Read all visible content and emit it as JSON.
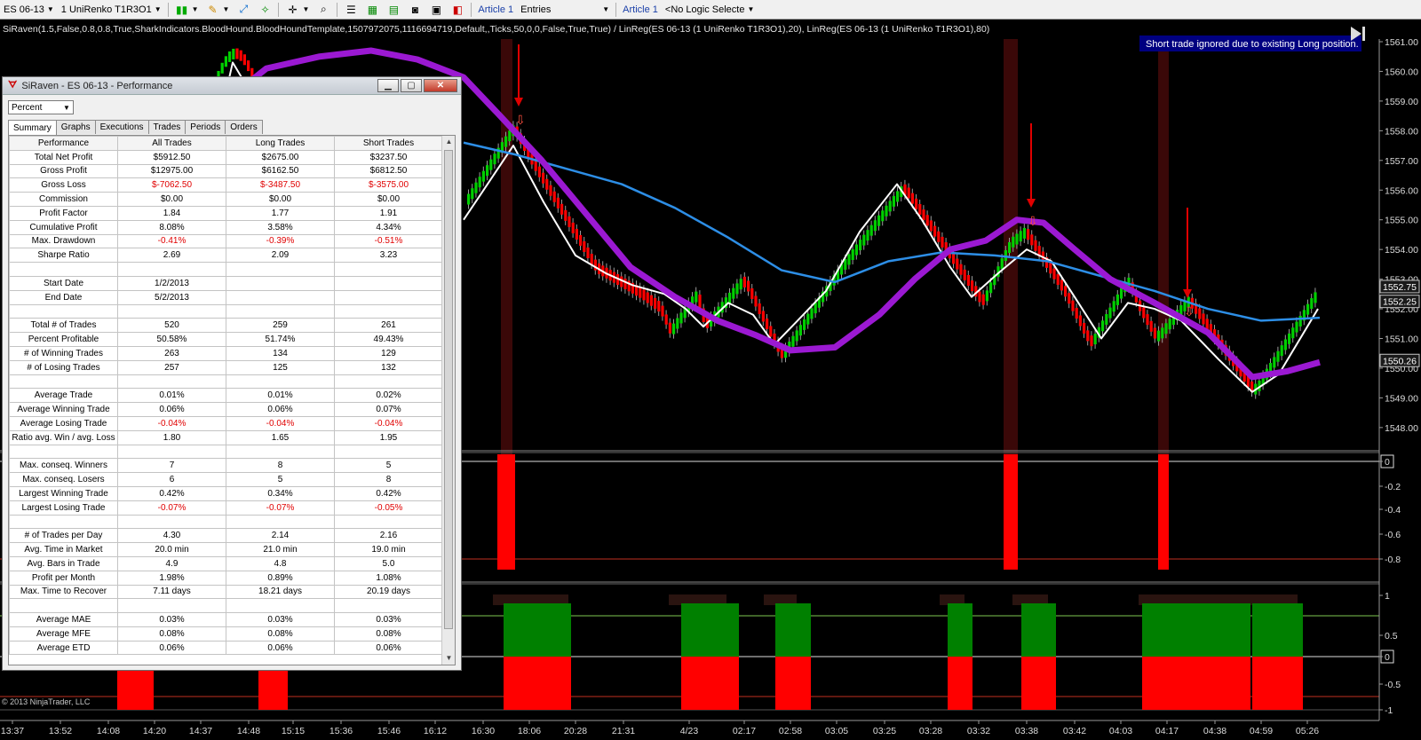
{
  "toolbar": {
    "instrument": "ES 06-13",
    "bar_type": "1 UniRenko T1R3O1",
    "article_a": "Article 1",
    "entries": "Entries",
    "article_b": "Article 1",
    "logic": "<No Logic Selecte"
  },
  "indicator_label": "SiRaven(1.5,False,0.8,0.8,True,SharkIndicators.BloodHound.BloodHoundTemplate,1507972075,1116694719,Default,,Ticks,50,0,0,False,True,True)  /  LinReg(ES 06-13 (1 UniRenko T1R3O1),20),  LinReg(ES 06-13 (1 UniRenko T1R3O1),80)",
  "notice": "Short trade ignored due to existing Long position.",
  "copyright": "© 2013 NinjaTrader, LLC",
  "price_axis": [
    "1561.00",
    "1560.00",
    "1559.00",
    "1558.00",
    "1557.00",
    "1556.00",
    "1555.00",
    "1554.00",
    "1553.00",
    "1552.00",
    "1551.00",
    "1550.00",
    "1549.00",
    "1548.00"
  ],
  "price_tags": [
    {
      "value": "1552.75",
      "color": "#c8c8c8"
    },
    {
      "value": "1552.25",
      "color": "#c8c8c8"
    },
    {
      "value": "1550.26",
      "color": "#c8c8c8"
    }
  ],
  "panel2_axis": [
    "0",
    "-0.2",
    "-0.4",
    "-0.6",
    "-0.8"
  ],
  "panel3_axis": [
    "1",
    "0.5",
    "0",
    "-0.5",
    "-1"
  ],
  "time_axis": [
    "13:37",
    "13:52",
    "14:08",
    "14:20",
    "14:37",
    "14:48",
    "15:15",
    "15:36",
    "15:46",
    "16:12",
    "16:30",
    "18:06",
    "20:28",
    "21:31",
    "4/23",
    "02:17",
    "02:58",
    "03:05",
    "03:25",
    "03:28",
    "03:32",
    "03:38",
    "03:42",
    "04:03",
    "04:17",
    "04:38",
    "04:59",
    "05:26"
  ],
  "colors": {
    "up": "#00d000",
    "down": "#ff0000",
    "linreg20": "#ffffff",
    "linreg80": "#2d8ee6",
    "siraven": "#9b19d2",
    "green_block": "#008000",
    "red_block": "#ff0000"
  },
  "perf": {
    "title": "SiRaven - ES 06-13 - Performance",
    "select": "Percent",
    "tabs": [
      "Summary",
      "Graphs",
      "Executions",
      "Trades",
      "Periods",
      "Orders"
    ],
    "headers": [
      "Performance",
      "All Trades",
      "Long Trades",
      "Short Trades"
    ],
    "rows": [
      [
        "Total Net Profit",
        "$5912.50",
        "$2675.00",
        "$3237.50"
      ],
      [
        "Gross Profit",
        "$12975.00",
        "$6162.50",
        "$6812.50"
      ],
      [
        "Gross Loss",
        "$-7062.50",
        "$-3487.50",
        "$-3575.00"
      ],
      [
        "Commission",
        "$0.00",
        "$0.00",
        "$0.00"
      ],
      [
        "Profit Factor",
        "1.84",
        "1.77",
        "1.91"
      ],
      [
        "Cumulative Profit",
        "8.08%",
        "3.58%",
        "4.34%"
      ],
      [
        "Max. Drawdown",
        "-0.41%",
        "-0.39%",
        "-0.51%"
      ],
      [
        "Sharpe Ratio",
        "2.69",
        "2.09",
        "3.23"
      ],
      [
        "",
        "",
        "",
        ""
      ],
      [
        "Start Date",
        "1/2/2013",
        "",
        ""
      ],
      [
        "End Date",
        "5/2/2013",
        "",
        ""
      ],
      [
        "",
        "",
        "",
        ""
      ],
      [
        "Total # of Trades",
        "520",
        "259",
        "261"
      ],
      [
        "Percent Profitable",
        "50.58%",
        "51.74%",
        "49.43%"
      ],
      [
        "# of Winning Trades",
        "263",
        "134",
        "129"
      ],
      [
        "# of Losing Trades",
        "257",
        "125",
        "132"
      ],
      [
        "",
        "",
        "",
        ""
      ],
      [
        "Average Trade",
        "0.01%",
        "0.01%",
        "0.02%"
      ],
      [
        "Average Winning Trade",
        "0.06%",
        "0.06%",
        "0.07%"
      ],
      [
        "Average Losing Trade",
        "-0.04%",
        "-0.04%",
        "-0.04%"
      ],
      [
        "Ratio avg. Win / avg. Loss",
        "1.80",
        "1.65",
        "1.95"
      ],
      [
        "",
        "",
        "",
        ""
      ],
      [
        "Max. conseq. Winners",
        "7",
        "8",
        "5"
      ],
      [
        "Max. conseq. Losers",
        "6",
        "5",
        "8"
      ],
      [
        "Largest Winning Trade",
        "0.42%",
        "0.34%",
        "0.42%"
      ],
      [
        "Largest Losing Trade",
        "-0.07%",
        "-0.07%",
        "-0.05%"
      ],
      [
        "",
        "",
        "",
        ""
      ],
      [
        "# of Trades per Day",
        "4.30",
        "2.14",
        "2.16"
      ],
      [
        "Avg. Time in Market",
        "20.0 min",
        "21.0 min",
        "19.0 min"
      ],
      [
        "Avg. Bars in Trade",
        "4.9",
        "4.8",
        "5.0"
      ],
      [
        "Profit per Month",
        "1.98%",
        "0.89%",
        "1.08%"
      ],
      [
        "Max. Time to Recover",
        "7.11 days",
        "18.21 days",
        "20.19 days"
      ],
      [
        "",
        "",
        "",
        ""
      ],
      [
        "Average MAE",
        "0.03%",
        "0.03%",
        "0.03%"
      ],
      [
        "Average MFE",
        "0.08%",
        "0.08%",
        "0.08%"
      ],
      [
        "Average ETD",
        "0.06%",
        "0.06%",
        "0.06%"
      ]
    ]
  }
}
